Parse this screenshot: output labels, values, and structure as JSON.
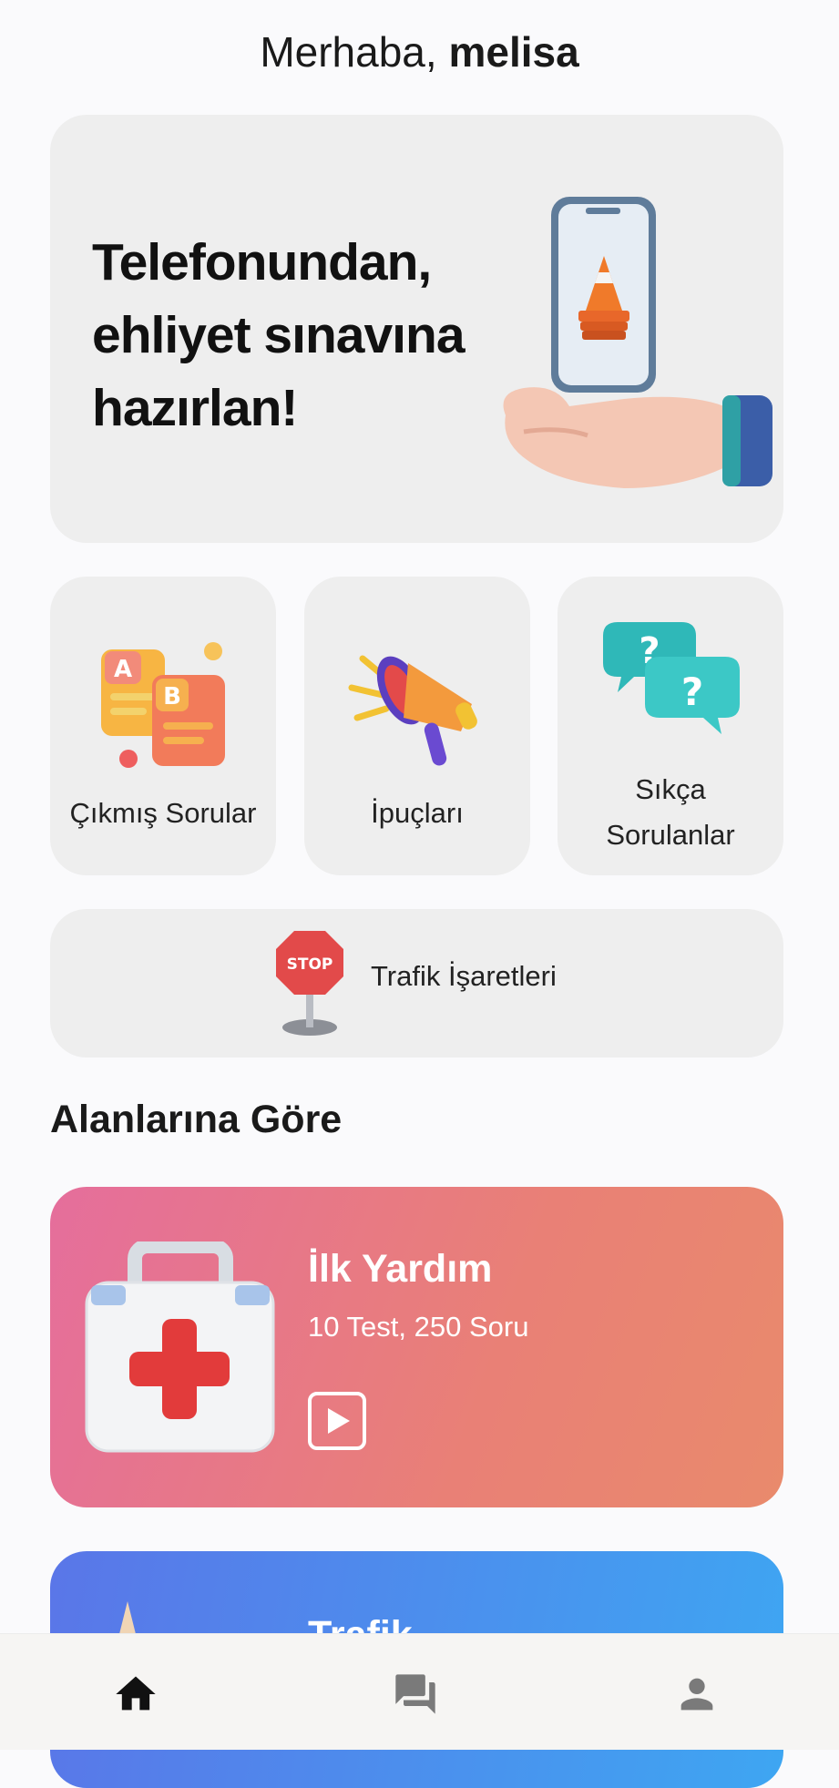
{
  "header": {
    "greeting_prefix": "Merhaba,",
    "user_name": "melisa"
  },
  "hero": {
    "line1": "Telefonundan,",
    "line2": "ehliyet sınavına",
    "line3": "hazırlan!"
  },
  "tiles": [
    {
      "label": "Çıkmış Sorular",
      "icon": "ab-quiz-cards-icon"
    },
    {
      "label": "İpuçları",
      "icon": "megaphone-icon"
    },
    {
      "label_line1": "Sıkça",
      "label_line2": "Sorulanlar",
      "icon": "question-bubbles-icon"
    }
  ],
  "signs": {
    "label": "Trafik İşaretleri",
    "icon": "stop-sign-icon"
  },
  "section": {
    "title": "Alanlarına Göre"
  },
  "categories": [
    {
      "title": "İlk Yardım",
      "subtitle": "10 Test, 250 Soru",
      "icon": "first-aid-kit-icon",
      "button_icon": "play-icon"
    },
    {
      "title": "Trafik",
      "icon": "traffic-icon"
    }
  ],
  "nav": [
    {
      "icon": "home-icon",
      "active": true
    },
    {
      "icon": "chat-icon",
      "active": false
    },
    {
      "icon": "person-icon",
      "active": false
    }
  ],
  "colors": {
    "background": "#fafafc",
    "card": "#eeeeee",
    "first_aid_gradient_start": "#e56e9c",
    "first_aid_gradient_end": "#e98a6c",
    "traffic_gradient_start": "#5a76e8",
    "traffic_gradient_end": "#3ea6f2"
  }
}
